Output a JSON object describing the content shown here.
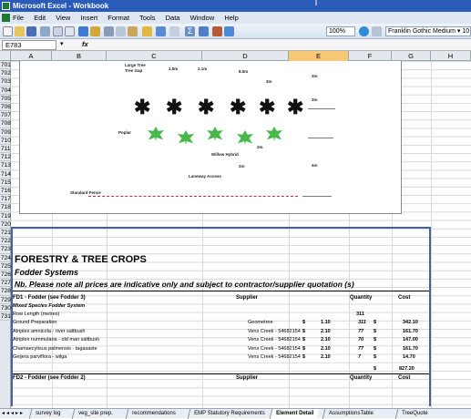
{
  "window": {
    "title": "Microsoft Excel - Workbook"
  },
  "menu": [
    "File",
    "Edit",
    "View",
    "Insert",
    "Format",
    "Tools",
    "Data",
    "Window",
    "Help"
  ],
  "toolbar": {
    "zoom": "100%",
    "font": "Franklin Gothic Medium",
    "font_size": "10"
  },
  "formula_bar": {
    "cell_ref": "E783",
    "fx": "fx",
    "value": ""
  },
  "columns": [
    "A",
    "B",
    "C",
    "D",
    "E",
    "F",
    "G",
    "H"
  ],
  "rows": [
    "701",
    "702",
    "703",
    "704",
    "705",
    "706",
    "707",
    "708",
    "709",
    "710",
    "711",
    "712",
    "713",
    "714",
    "715",
    "716",
    "717",
    "718",
    "719",
    "720",
    "721",
    "722",
    "723",
    "724",
    "725",
    "726",
    "727",
    "728",
    "729",
    "730",
    "731"
  ],
  "diagram": {
    "labels": {
      "large_tree": "Large Tree",
      "tree_gap": "Tree Gap",
      "d1": "1.5m",
      "d2": "2.1m",
      "d3": "8.5m",
      "d4": "3m",
      "d5": "3m",
      "d6": "3m",
      "poplar": "Poplar",
      "d7": "2m",
      "willow": "Willow Hybrid",
      "d8": "2m",
      "d9": "4m",
      "laneway": "Laneway Access",
      "fence": "Standard Fence"
    }
  },
  "sheet": {
    "title": "FORESTRY & TREE CROPS",
    "subtitle": "Fodder Systems",
    "note": "Nb. Please note all prices are indicative only and subject to contractor/supplier quotation (s)",
    "section1": {
      "heading": "FD1 - Fodder (see Fodder 3)",
      "col_supplier": "Supplier",
      "col_quantity": "Quantity",
      "col_cost": "Cost",
      "subheading": "Mixed Species Fodder System",
      "row_length": {
        "label": "Row Length (metres)",
        "quantity": "311"
      },
      "items": [
        {
          "item": "Ground Preparation",
          "supplier": "Geometree",
          "cur": "$",
          "rate": "1.10",
          "qty": "311",
          "cost_cur": "$",
          "cost": "342.10"
        },
        {
          "item": "Atriplex amnicola - river saltbush",
          "supplier": "Vens Creek - 54682154",
          "cur": "$",
          "rate": "2.10",
          "qty": "77",
          "cost_cur": "$",
          "cost": "161.70"
        },
        {
          "item": "Atriplex nummularia - old man saltbush",
          "supplier": "Vens Creek - 54682154",
          "cur": "$",
          "rate": "2.10",
          "qty": "70",
          "cost_cur": "$",
          "cost": "147.00"
        },
        {
          "item": "Chamaecytisus palmensis - tagasaste",
          "supplier": "Vens Creek - 54682154",
          "cur": "$",
          "rate": "2.10",
          "qty": "77",
          "cost_cur": "$",
          "cost": "161.70"
        },
        {
          "item": "Geijera parviflora - wilga",
          "supplier": "Vens Creek - 54682154",
          "cur": "$",
          "rate": "2.10",
          "qty": "7",
          "cost_cur": "$",
          "cost": "14.70"
        }
      ],
      "total": {
        "cur": "$",
        "value": "827.20"
      }
    },
    "section2": {
      "heading": "FD2 - Fodder (see Fodder 2)",
      "col_supplier": "Supplier",
      "col_quantity": "Quantity",
      "col_cost": "Cost"
    }
  },
  "tabs": [
    "survey log",
    "veg_site prep.",
    "recommendations",
    "EMP Statutory Requirements",
    "Element Detail",
    "AssumptionsTable",
    "TreeQuote"
  ],
  "active_tab": "Element Detail"
}
